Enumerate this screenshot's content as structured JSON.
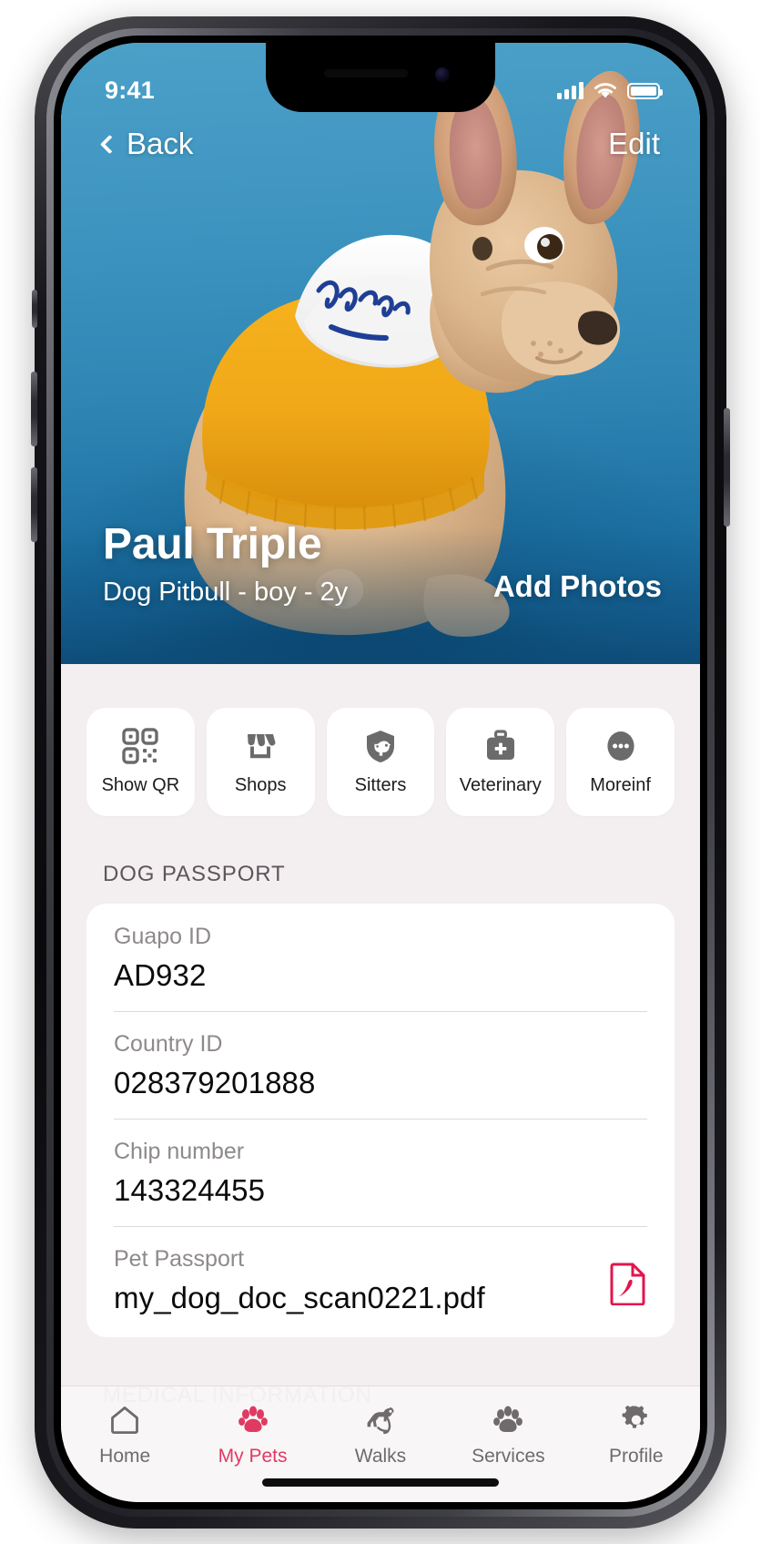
{
  "status_bar": {
    "time": "9:41",
    "signal_icon": "cellular-signal-icon",
    "wifi_icon": "wifi-icon",
    "battery_icon": "battery-icon"
  },
  "hero": {
    "back_label": "Back",
    "back_icon": "chevron-left-icon",
    "edit_label": "Edit",
    "pet_name": "Paul Triple",
    "pet_subtitle": "Dog Pitbull - boy - 2y",
    "add_photos_label": "Add Photos",
    "background_color": "#2f86b4"
  },
  "quick_actions": [
    {
      "label": "Show QR",
      "icon": "qr-code-icon"
    },
    {
      "label": "Shops",
      "icon": "storefront-icon"
    },
    {
      "label": "Sitters",
      "icon": "shield-dog-icon"
    },
    {
      "label": "Veterinary",
      "icon": "medical-kit-icon"
    },
    {
      "label": "Moreinf",
      "icon": "ellipsis-icon"
    }
  ],
  "sections": {
    "passport_title": "DOG PASSPORT",
    "medical_title": "MEDICAL INFORMATION"
  },
  "passport_fields": [
    {
      "key": "Guapo ID",
      "value": "AD932"
    },
    {
      "key": "Country ID",
      "value": "028379201888"
    },
    {
      "key": "Chip number",
      "value": "143324455"
    },
    {
      "key": "Pet Passport",
      "value": "my_dog_doc_scan0221.pdf",
      "trailing_icon": "pdf-file-icon"
    }
  ],
  "tab_bar": {
    "active_color": "#e03a62",
    "inactive_color": "#6f6b6d",
    "items": [
      {
        "label": "Home",
        "icon": "house-icon",
        "active": false
      },
      {
        "label": "My Pets",
        "icon": "paw-icon",
        "active": true
      },
      {
        "label": "Walks",
        "icon": "dog-leash-icon",
        "active": false
      },
      {
        "label": "Services",
        "icon": "paw-gear-icon",
        "active": false
      },
      {
        "label": "Profile",
        "icon": "gear-icon",
        "active": false
      }
    ]
  }
}
